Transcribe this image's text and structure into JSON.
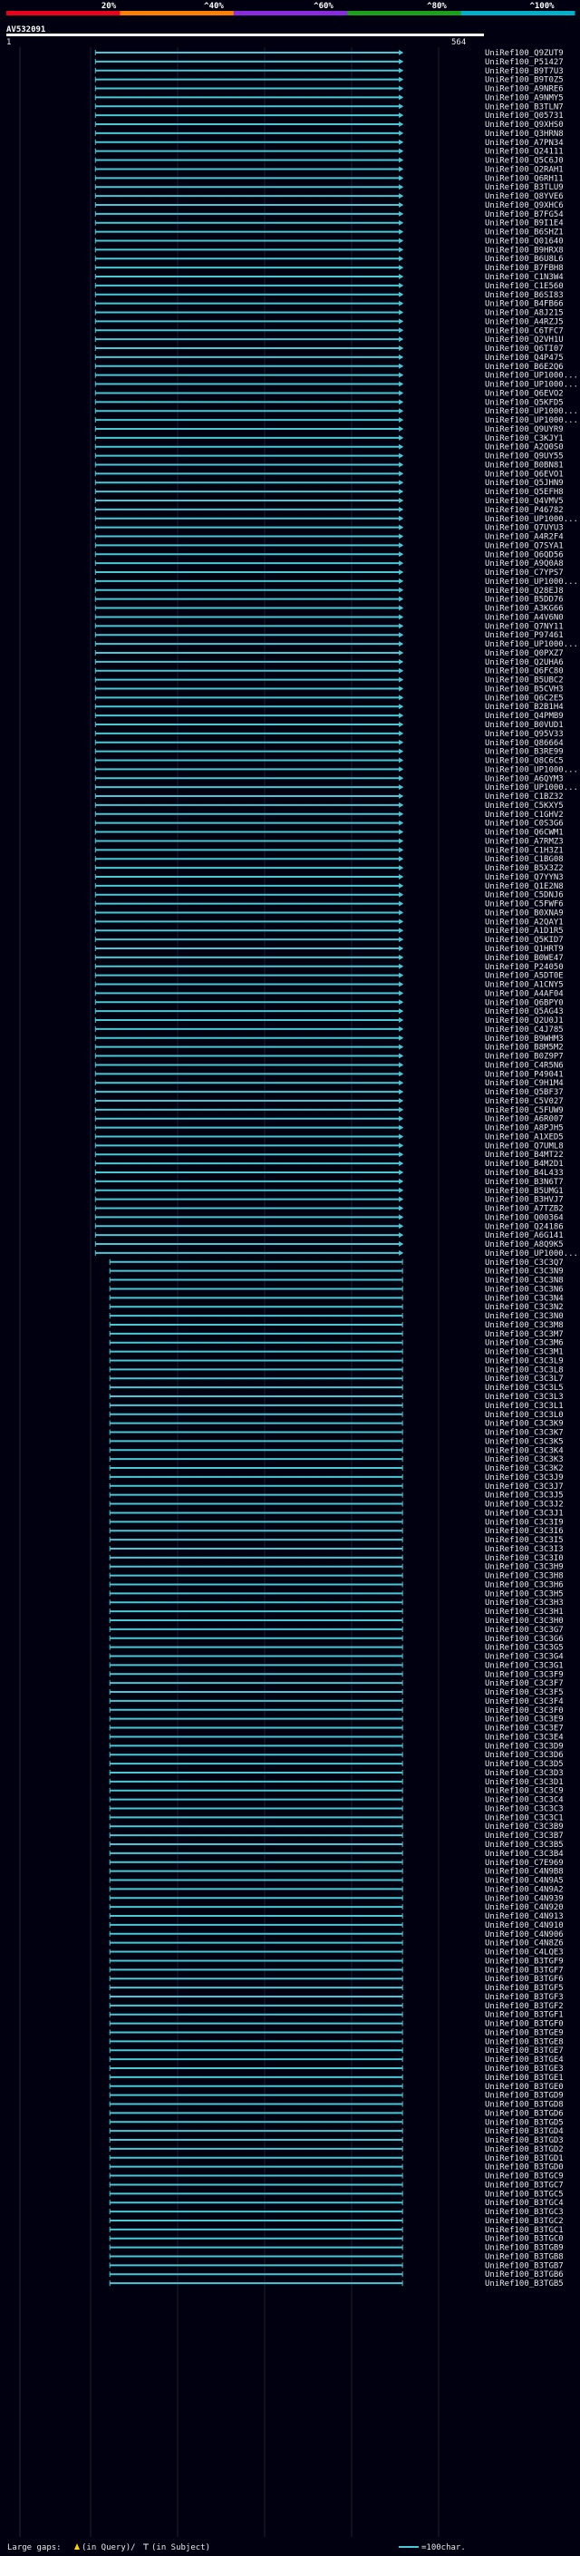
{
  "chart_data": {
    "type": "alignment",
    "query": "AV532091",
    "ruler": {
      "start": "1",
      "end": "564"
    },
    "scale": {
      "ticks": [
        "20%",
        "^40%",
        "^60%",
        "^80%",
        "^100%"
      ],
      "colors": [
        "#e8001c",
        "#ff7f00",
        "#8a2be2",
        "#1aa019",
        "#00b0c8"
      ]
    },
    "line_color": "#48c8d4",
    "hits_group_a": {
      "start": 106,
      "end": 468,
      "arrows": "right",
      "ids": [
        "UniRef100_Q9ZUT9",
        "UniRef100_P51427",
        "UniRef100_B9T7U3",
        "UniRef100_B9T0Z5",
        "UniRef100_A9NRE6",
        "UniRef100_A9NMY5",
        "UniRef100_B3TLN7",
        "UniRef100_Q05731",
        "UniRef100_Q9XHS0",
        "UniRef100_Q3HRN8",
        "UniRef100_A7PN34",
        "UniRef100_Q24111",
        "UniRef100_Q5C6J0",
        "UniRef100_Q2RAH1",
        "UniRef100_Q6RH11",
        "UniRef100_B3TLU9",
        "UniRef100_Q8YVE6",
        "UniRef100_Q9XHC6",
        "UniRef100_B7FG54",
        "UniRef100_B9I1E4",
        "UniRef100_B6SHZ1",
        "UniRef100_Q01640",
        "UniRef100_B9HRX8",
        "UniRef100_B6U8L6",
        "UniRef100_B7FBH8",
        "UniRef100_C1N3W4",
        "UniRef100_C1E560",
        "UniRef100_B6SI83",
        "UniRef100_B4FB66",
        "UniRef100_A8J215",
        "UniRef100_A4RZJ5",
        "UniRef100_C6TFC7",
        "UniRef100_Q2VH1U",
        "UniRef100_Q6TI07",
        "UniRef100_Q4P475",
        "UniRef100_B6E2Q6",
        "UniRef100_UP1000...",
        "UniRef100_UP1000...",
        "UniRef100_Q6EVO2",
        "UniRef100_Q5KFD5",
        "UniRef100_UP1000...",
        "UniRef100_UP1000...",
        "UniRef100_Q9UYR9",
        "UniRef100_C3KJY1",
        "UniRef100_A2Q0S0",
        "UniRef100_Q9UY55",
        "UniRef100_B0BN81",
        "UniRef100_Q6EVO1",
        "UniRef100_Q5JHN9",
        "UniRef100_Q5EFH8",
        "UniRef100_Q4VMV5",
        "UniRef100_P46782",
        "UniRef100_UP1000...",
        "UniRef100_Q7UYU3",
        "UniRef100_A4R2F4",
        "UniRef100_Q7SYA1",
        "UniRef100_Q6QD56",
        "UniRef100_A9Q0A8",
        "UniRef100_C7YPS7",
        "UniRef100_UP1000...",
        "UniRef100_Q28EJ8",
        "UniRef100_B5DD76",
        "UniRef100_A3KG66",
        "UniRef100_A4V6N0",
        "UniRef100_Q7NY11",
        "UniRef100_P97461",
        "UniRef100_UP1000...",
        "UniRef100_Q0PXZ7",
        "UniRef100_Q2UHA6",
        "UniRef100_Q6FC80",
        "UniRef100_B5UBC2",
        "UniRef100_B5CVH3",
        "UniRef100_Q6C2E5",
        "UniRef100_B2B1H4",
        "UniRef100_Q4PMB9",
        "UniRef100_B0VUD1",
        "UniRef100_Q95V33",
        "UniRef100_Q86664",
        "UniRef100_B3RE99",
        "UniRef100_Q8C6C5",
        "UniRef100_UP1000...",
        "UniRef100_A6QYM3",
        "UniRef100_UP1000...",
        "UniRef100_C1BZ32",
        "UniRef100_C5KXY5",
        "UniRef100_C1GHV2",
        "UniRef100_C0S3G6",
        "UniRef100_Q6CWM1",
        "UniRef100_A7RMZ3",
        "UniRef100_C1H3Z1",
        "UniRef100_C1BG08",
        "UniRef100_B5X3Z2",
        "UniRef100_Q7YYN3",
        "UniRef100_Q1E2N8",
        "UniRef100_C5DNJ6",
        "UniRef100_C5FWF6",
        "UniRef100_B0XNA9",
        "UniRef100_A2QAY1",
        "UniRef100_A1D1R5",
        "UniRef100_Q5KID7",
        "UniRef100_Q1HRT9",
        "UniRef100_B0WE47",
        "UniRef100_P24050",
        "UniRef100_A5DT0E",
        "UniRef100_A1CNY5",
        "UniRef100_A4AF04",
        "UniRef100_Q6BPY0",
        "UniRef100_Q5AG43",
        "UniRef100_Q2U0J1",
        "UniRef100_C4J785",
        "UniRef100_B9WHM3",
        "UniRef100_B8M5M2",
        "UniRef100_B0Z9P7",
        "UniRef100_C4R5N6",
        "UniRef100_P49041",
        "UniRef100_C9H1M4",
        "UniRef100_Q5BF37",
        "UniRef100_C5V027",
        "UniRef100_C5FUW9",
        "UniRef100_A6R007",
        "UniRef100_A8PJH5",
        "UniRef100_A1XED5",
        "UniRef100_Q7UML8",
        "UniRef100_B4MT22",
        "UniRef100_B4M2D1",
        "UniRef100_B4L433",
        "UniRef100_B3N6T7",
        "UniRef100_B5UMG1",
        "UniRef100_B3HVJ7",
        "UniRef100_A7TZB2",
        "UniRef100_Q00364",
        "UniRef100_Q24186",
        "UniRef100_A6G141",
        "UniRef100_A8Q9K5",
        "UniRef100_UP1000..."
      ]
    },
    "hits_group_b": {
      "start": 123,
      "end": 468,
      "arrows": "none",
      "ids": [
        "UniRef100_C3C3Q7",
        "UniRef100_C3C3N9",
        "UniRef100_C3C3N8",
        "UniRef100_C3C3N6",
        "UniRef100_C3C3N4",
        "UniRef100_C3C3N2",
        "UniRef100_C3C3N0",
        "UniRef100_C3C3M8",
        "UniRef100_C3C3M7",
        "UniRef100_C3C3M6",
        "UniRef100_C3C3M1",
        "UniRef100_C3C3L9",
        "UniRef100_C3C3L8",
        "UniRef100_C3C3L7",
        "UniRef100_C3C3L5",
        "UniRef100_C3C3L3",
        "UniRef100_C3C3L1",
        "UniRef100_C3C3L0",
        "UniRef100_C3C3K9",
        "UniRef100_C3C3K7",
        "UniRef100_C3C3K5",
        "UniRef100_C3C3K4",
        "UniRef100_C3C3K3",
        "UniRef100_C3C3K2",
        "UniRef100_C3C3J9",
        "UniRef100_C3C3J7",
        "UniRef100_C3C3J5",
        "UniRef100_C3C3J2",
        "UniRef100_C3C3J1",
        "UniRef100_C3C3I9",
        "UniRef100_C3C3I6",
        "UniRef100_C3C3I5",
        "UniRef100_C3C3I3",
        "UniRef100_C3C3I0",
        "UniRef100_C3C3H9",
        "UniRef100_C3C3H8",
        "UniRef100_C3C3H6",
        "UniRef100_C3C3H5",
        "UniRef100_C3C3H3",
        "UniRef100_C3C3H1",
        "UniRef100_C3C3H0",
        "UniRef100_C3C3G7",
        "UniRef100_C3C3G6",
        "UniRef100_C3C3G5",
        "UniRef100_C3C3G4",
        "UniRef100_C3C3G1",
        "UniRef100_C3C3F9",
        "UniRef100_C3C3F7",
        "UniRef100_C3C3F5",
        "UniRef100_C3C3F4",
        "UniRef100_C3C3F0",
        "UniRef100_C3C3E9",
        "UniRef100_C3C3E7",
        "UniRef100_C3C3E4",
        "UniRef100_C3C3D9",
        "UniRef100_C3C3D6",
        "UniRef100_C3C3D5",
        "UniRef100_C3C3D3",
        "UniRef100_C3C3D1",
        "UniRef100_C3C3C9",
        "UniRef100_C3C3C4",
        "UniRef100_C3C3C3",
        "UniRef100_C3C3C1",
        "UniRef100_C3C3B9",
        "UniRef100_C3C3B7",
        "UniRef100_C3C3B5",
        "UniRef100_C3C3B4",
        "UniRef100_C7E969",
        "UniRef100_C4N9B8",
        "UniRef100_C4N9A5",
        "UniRef100_C4N9A2",
        "UniRef100_C4N939",
        "UniRef100_C4N920",
        "UniRef100_C4N913",
        "UniRef100_C4N910",
        "UniRef100_C4N906",
        "UniRef100_C4N8Z6",
        "UniRef100_C4LQE3",
        "UniRef100_B3TGF9",
        "UniRef100_B3TGF7",
        "UniRef100_B3TGF6",
        "UniRef100_B3TGF5",
        "UniRef100_B3TGF3",
        "UniRef100_B3TGF2",
        "UniRef100_B3TGF1",
        "UniRef100_B3TGF0",
        "UniRef100_B3TGE9",
        "UniRef100_B3TGE8",
        "UniRef100_B3TGE7",
        "UniRef100_B3TGE4",
        "UniRef100_B3TGE3",
        "UniRef100_B3TGE1",
        "UniRef100_B3TGE0",
        "UniRef100_B3TGD9",
        "UniRef100_B3TGD8",
        "UniRef100_B3TGD6",
        "UniRef100_B3TGD5",
        "UniRef100_B3TGD4",
        "UniRef100_B3TGD3",
        "UniRef100_B3TGD2",
        "UniRef100_B3TGD1",
        "UniRef100_B3TGD0",
        "UniRef100_B3TGC9",
        "UniRef100_B3TGC7",
        "UniRef100_B3TGC5",
        "UniRef100_B3TGC4",
        "UniRef100_B3TGC3",
        "UniRef100_B3TGC2",
        "UniRef100_B3TGC1",
        "UniRef100_B3TGC0",
        "UniRef100_B3TGB9",
        "UniRef100_B3TGB8",
        "UniRef100_B3TGB7",
        "UniRef100_B3TGB6",
        "UniRef100_B3TGB5"
      ]
    },
    "legend": {
      "gaps_label": "Large gaps:",
      "in_query": "(in Query)/",
      "in_subject": "(in Subject)",
      "scale_label": "=100char."
    }
  }
}
